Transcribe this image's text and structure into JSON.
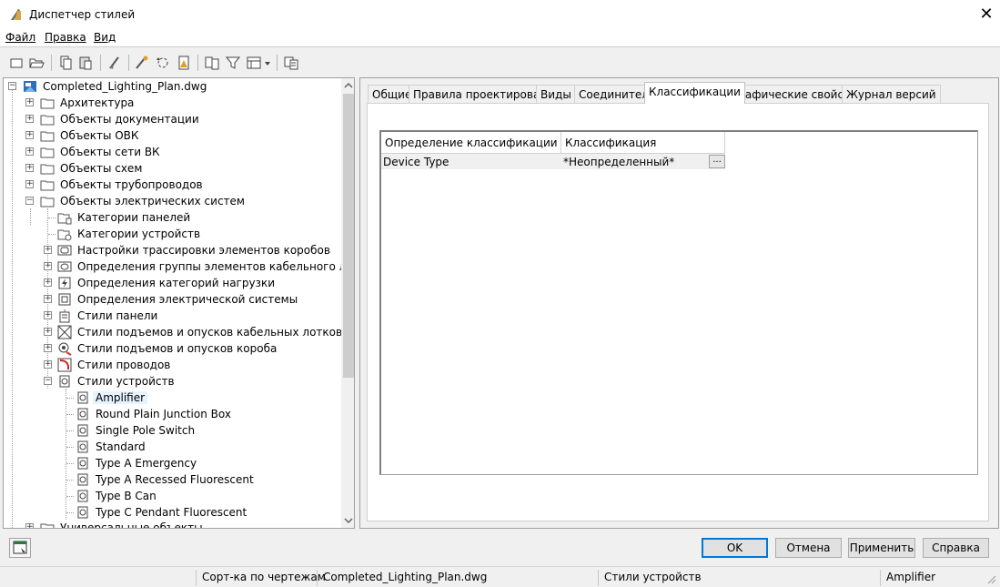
{
  "window": {
    "title": "Диспетчер стилей",
    "close_glyph": "✕"
  },
  "menu": [
    "Файл",
    "Правка",
    "Вид"
  ],
  "toolbar_icons": [
    "new-icon",
    "open-icon",
    "copy-icon",
    "paste-icon",
    "purge-icon",
    "edit-style-icon",
    "sync-icon",
    "warning-icon",
    "compare-icon",
    "filter-icon",
    "view-icon",
    "dropdown-icon",
    "toggle-view-icon"
  ],
  "tree": {
    "root": "Completed_Lighting_Plan.dwg",
    "level1": [
      "Архитектура",
      "Объекты документации",
      "Объекты ОВК",
      "Объекты сети ВК",
      "Объекты схем",
      "Объекты трубопроводов",
      "Объекты электрических систем"
    ],
    "electrical": [
      "Категории панелей",
      "Категории устройств",
      "Настройки трассировки элементов коробов",
      "Определения группы элементов кабельного лотка",
      "Определения категорий нагрузки",
      "Определения электрической системы",
      "Стили панели",
      "Стили подъемов и опусков кабельных лотков",
      "Стили подъемов и опусков короба",
      "Стили проводов",
      "Стили устройств"
    ],
    "devices": [
      "Amplifier",
      "Round Plain Junction Box",
      "Single Pole Switch",
      "Standard",
      "Type A Emergency",
      "Type A Recessed Fluorescent",
      "Type B Can",
      "Type C Pendant Fluorescent"
    ],
    "last": "Универсальные объекты"
  },
  "tabs": [
    "Общие",
    "Правила проектирования",
    "Виды",
    "Соединители",
    "Классификации",
    "Графические свойства",
    "Журнал версий"
  ],
  "active_tab": "Классификации",
  "grid": {
    "headers": [
      "Определение классификации",
      "Классификация"
    ],
    "rows": [
      {
        "definition": "Device Type",
        "classification": "*Неопределенный*",
        "button": "..."
      }
    ]
  },
  "buttons": {
    "ok": "OK",
    "cancel": "Отмена",
    "apply": "Применить",
    "help": "Справка"
  },
  "status": {
    "sort": "Сорт-ка по чертежам",
    "drawing": "Completed_Lighting_Plan.dwg",
    "category": "Стили устройств",
    "style": "Amplifier"
  },
  "colors": {
    "accent": "#0078d7",
    "selection": "#e5f3ff"
  }
}
